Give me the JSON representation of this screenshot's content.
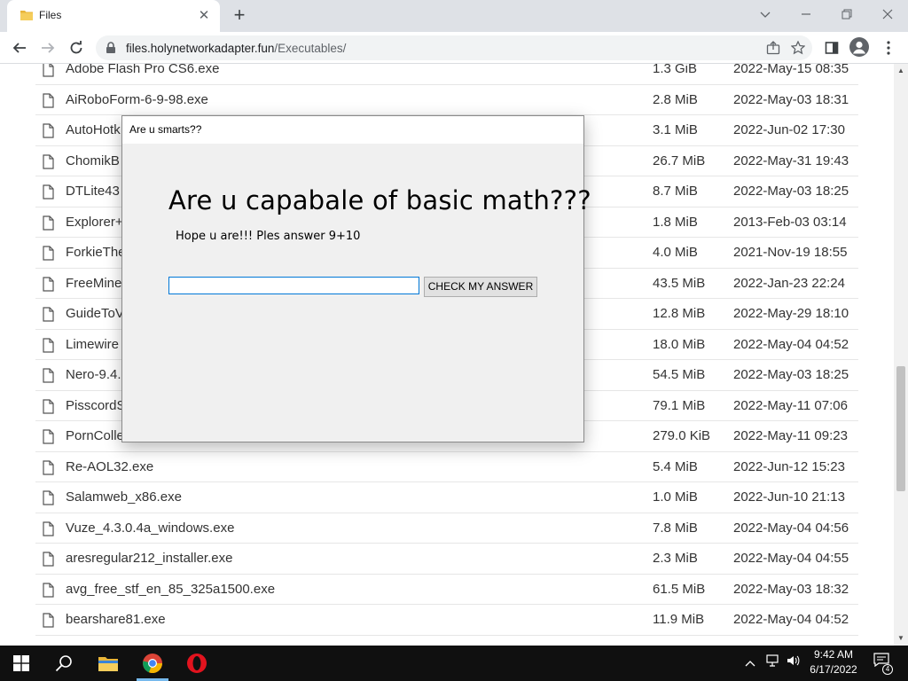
{
  "browser": {
    "tab": {
      "title": "Files",
      "favicon": "folder-icon"
    },
    "window_controls": [
      "chevron-down-icon",
      "minimize-icon",
      "restore-icon",
      "close-icon"
    ],
    "address": {
      "host": "files.holynetworkadapter.fun",
      "path": "/Executables/"
    }
  },
  "files": [
    {
      "name": "Adobe Flash Pro CS6.exe",
      "size": "1.3 GiB",
      "date": "2022-May-15 08:35"
    },
    {
      "name": "AiRoboForm-6-9-98.exe",
      "size": "2.8 MiB",
      "date": "2022-May-03 18:31"
    },
    {
      "name": "AutoHotk",
      "size": "3.1 MiB",
      "date": "2022-Jun-02 17:30"
    },
    {
      "name": "ChomikB",
      "size": "26.7 MiB",
      "date": "2022-May-31 19:43"
    },
    {
      "name": "DTLite43",
      "size": "8.7 MiB",
      "date": "2022-May-03 18:25"
    },
    {
      "name": "Explorer+",
      "size": "1.8 MiB",
      "date": "2013-Feb-03 03:14"
    },
    {
      "name": "ForkieThe",
      "size": "4.0 MiB",
      "date": "2021-Nov-19 18:55"
    },
    {
      "name": "FreeMine",
      "size": "43.5 MiB",
      "date": "2022-Jan-23 22:24"
    },
    {
      "name": "GuideToV",
      "size": "12.8 MiB",
      "date": "2022-May-29 18:10"
    },
    {
      "name": "Limewire",
      "size": "18.0 MiB",
      "date": "2022-May-04 04:52"
    },
    {
      "name": "Nero-9.4.",
      "size": "54.5 MiB",
      "date": "2022-May-03 18:25"
    },
    {
      "name": "PisscordS",
      "size": "79.1 MiB",
      "date": "2022-May-11 07:06"
    },
    {
      "name": "PornCollectionLeak.exe",
      "size": "279.0 KiB",
      "date": "2022-May-11 09:23"
    },
    {
      "name": "Re-AOL32.exe",
      "size": "5.4 MiB",
      "date": "2022-Jun-12 15:23"
    },
    {
      "name": "Salamweb_x86.exe",
      "size": "1.0 MiB",
      "date": "2022-Jun-10 21:13"
    },
    {
      "name": "Vuze_4.3.0.4a_windows.exe",
      "size": "7.8 MiB",
      "date": "2022-May-04 04:56"
    },
    {
      "name": "aresregular212_installer.exe",
      "size": "2.3 MiB",
      "date": "2022-May-04 04:55"
    },
    {
      "name": "avg_free_stf_en_85_325a1500.exe",
      "size": "61.5 MiB",
      "date": "2022-May-03 18:32"
    },
    {
      "name": "bearshare81.exe",
      "size": "11.9 MiB",
      "date": "2022-May-04 04:52"
    }
  ],
  "dialog": {
    "title": "Are u smarts??",
    "heading": "Are u capabale of basic math???",
    "subtext": "Hope u are!!! Ples answer 9+10",
    "input_value": "",
    "button_label": "CHECK MY ANSWER"
  },
  "taskbar": {
    "apps": [
      "windows-start-icon",
      "search-icon",
      "file-explorer-icon",
      "chrome-icon",
      "opera-icon"
    ],
    "time": "9:42 AM",
    "date": "6/17/2022",
    "notifications": "4"
  }
}
